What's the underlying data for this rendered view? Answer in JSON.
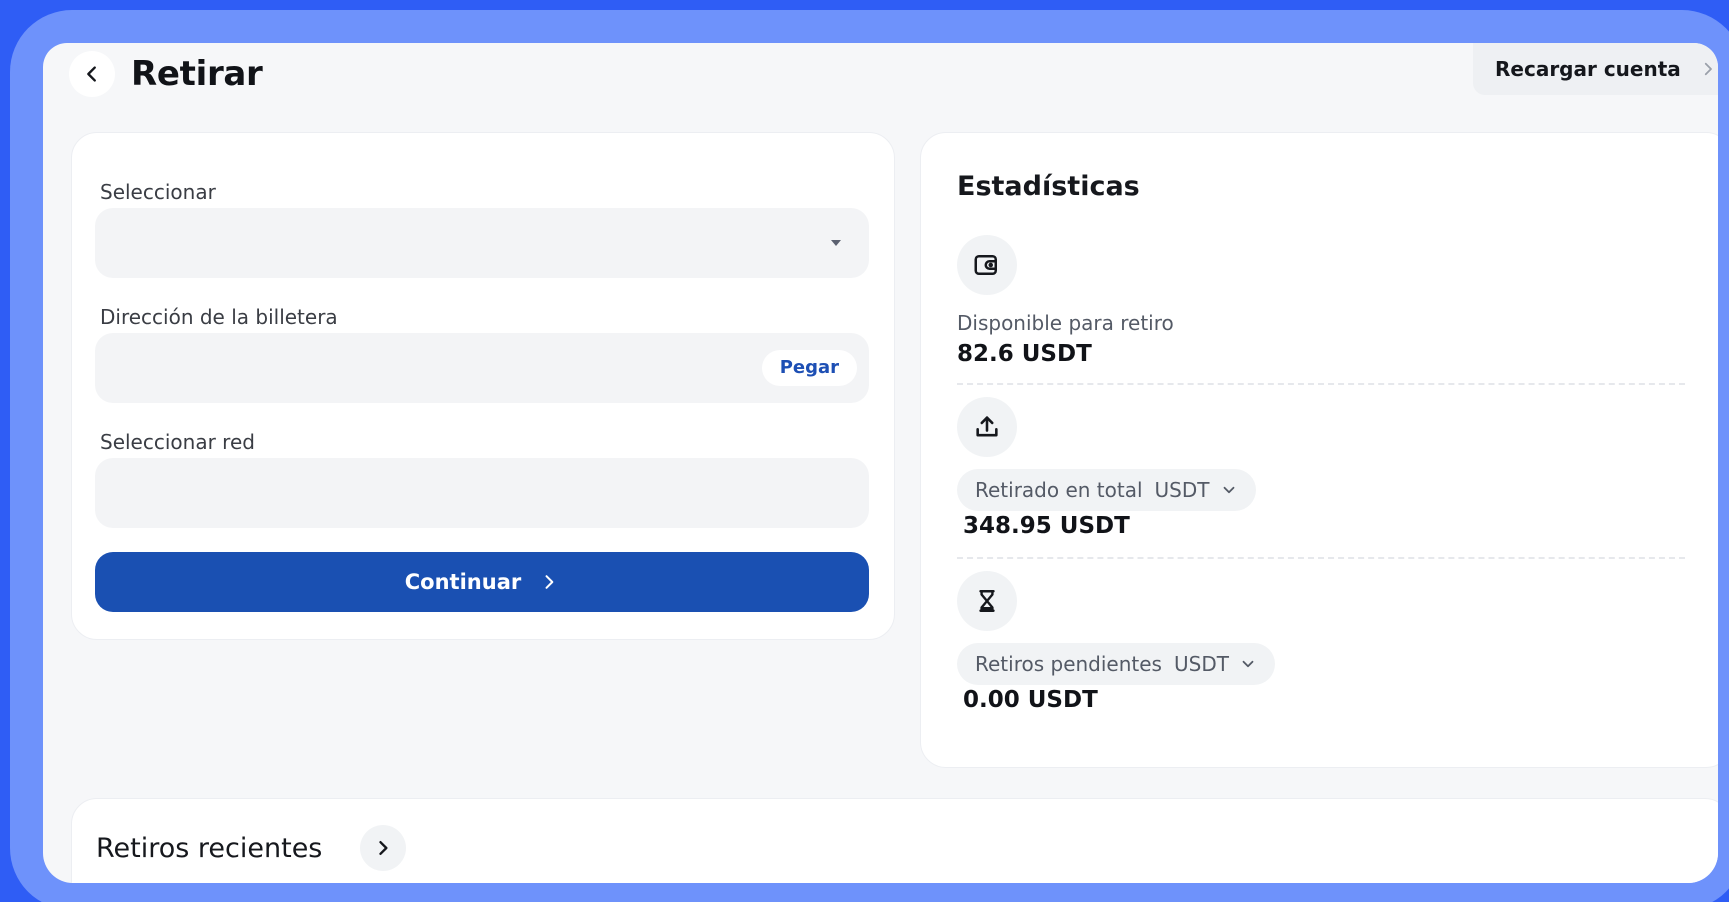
{
  "header": {
    "title": "Retirar",
    "recharge_label": "Recargar cuenta"
  },
  "form": {
    "select_label": "Seleccionar",
    "select_value": "",
    "wallet_label": "Dirección de la billetera",
    "wallet_value": "",
    "paste_label": "Pegar",
    "network_label": "Seleccionar red",
    "network_value": "",
    "continue_label": "Continuar"
  },
  "stats": {
    "title": "Estadísticas",
    "available_label": "Disponible para retiro",
    "available_value": "82.6 USDT",
    "withdrawn_label": "Retirado en total",
    "withdrawn_unit": "USDT",
    "withdrawn_value": "348.95 USDT",
    "pending_label": "Retiros pendientes",
    "pending_unit": "USDT",
    "pending_value": "0.00 USDT"
  },
  "recent": {
    "title": "Retiros recientes"
  },
  "icons": {
    "back": "chevron-left-icon",
    "recharge": "chevron-right-icon",
    "available": "wallet-icon",
    "withdrawn": "upload-icon",
    "pending": "hourglass-icon"
  },
  "colors": {
    "primary": "#1a50b2",
    "frame": "#6e92fb",
    "background": "#2f5df5"
  }
}
